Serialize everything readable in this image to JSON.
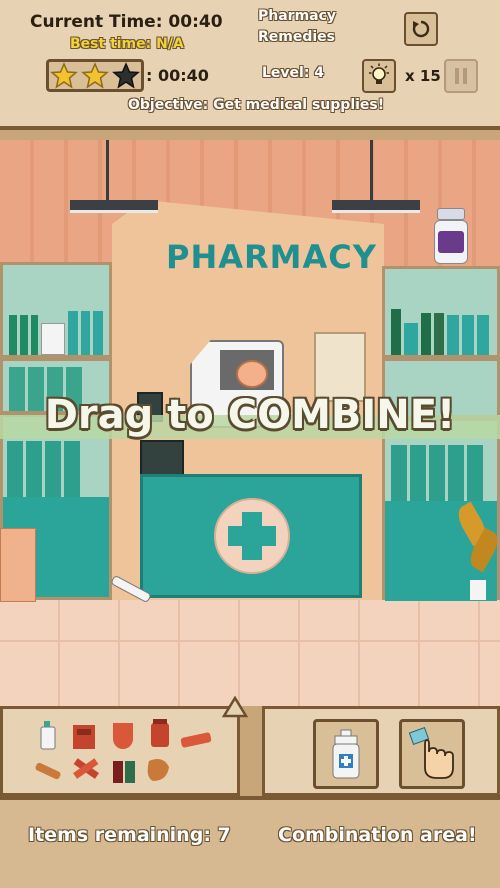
{
  "header": {
    "current_time_label": "Current Time: 00:40",
    "best_time_label": "Best time: N/A",
    "stars_time": ": 00:40",
    "stars_earned": 2,
    "stars_total": 3,
    "title_line1": "Pharmacy",
    "title_line2": "Remedies",
    "level_label": "Level: 4",
    "hints_count": "x 15",
    "objective": "Objective: Get medical supplies!"
  },
  "scene": {
    "sign_text": "PHARMACY",
    "banner_text": "Drag to COMBINE!"
  },
  "footer": {
    "items_remaining": "Items remaining: 7",
    "combination_area": "Combination area!"
  },
  "icons": {
    "restart": "restart-icon",
    "hint": "lightbulb-icon",
    "pause": "pause-icon"
  },
  "colors": {
    "panel": "#e7d3b3",
    "border": "#7a5a35",
    "teal": "#2ba59a",
    "star": "#f2c230",
    "banner": "#f3f8e8"
  }
}
